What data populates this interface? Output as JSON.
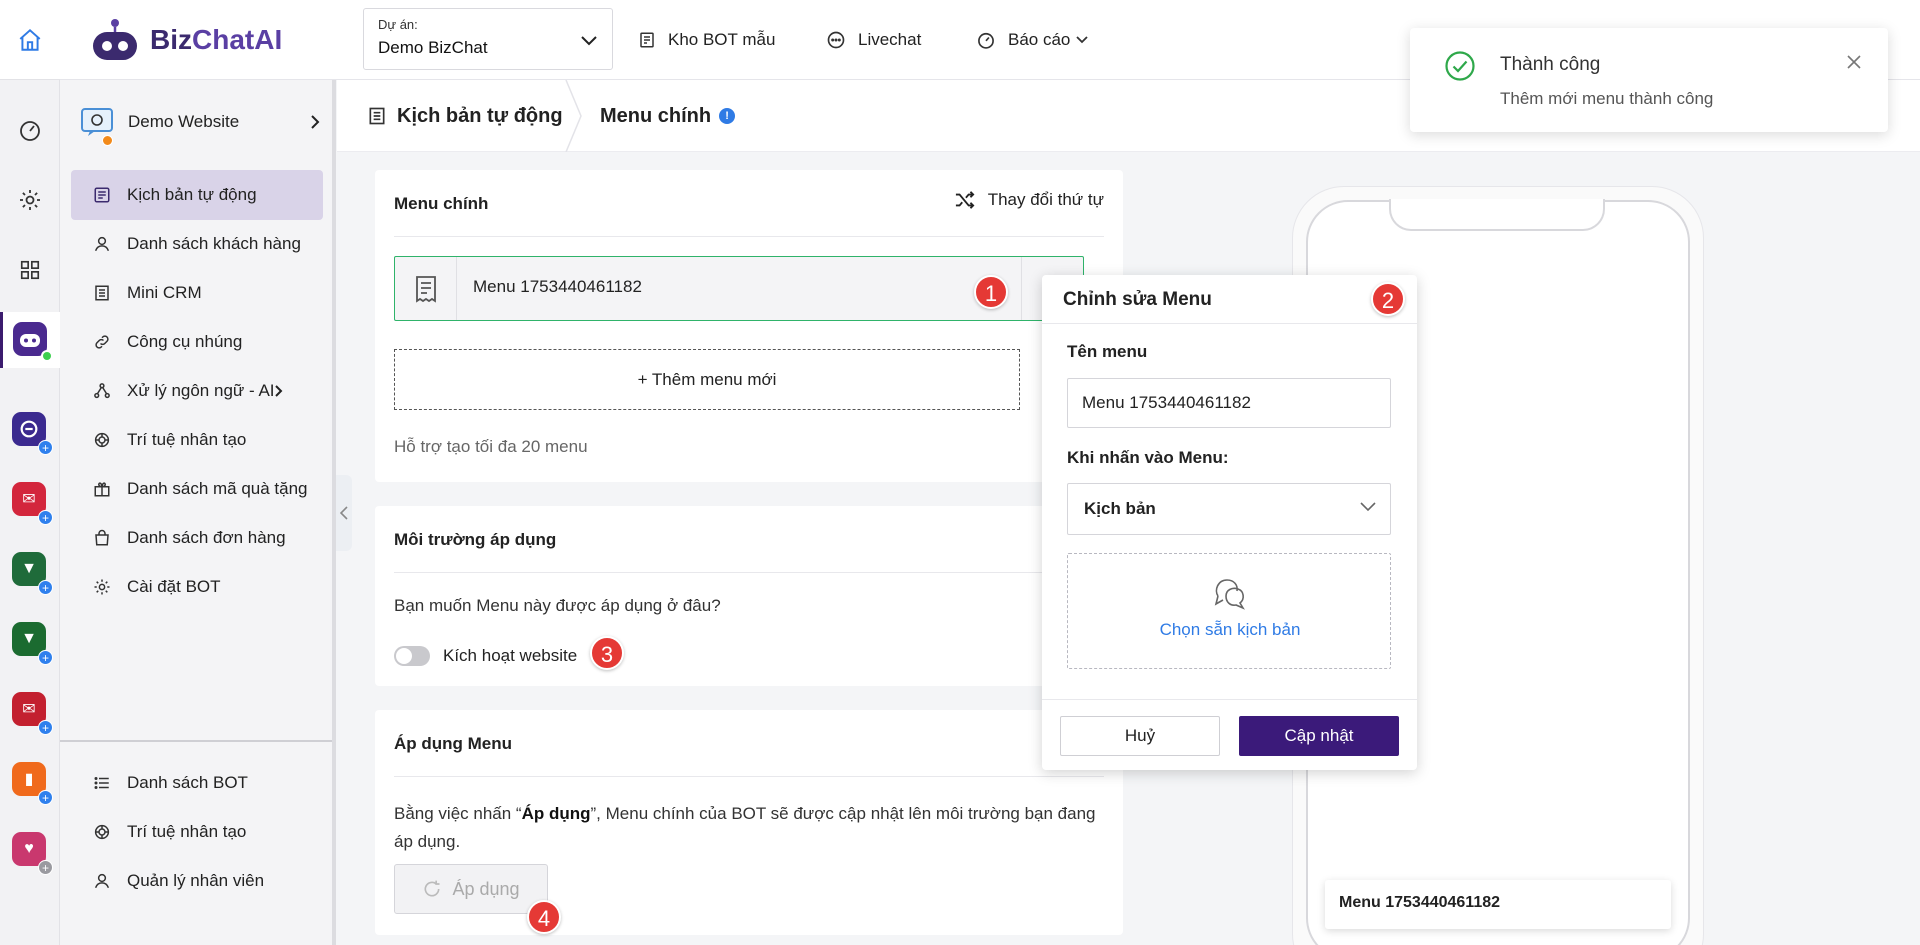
{
  "brand": {
    "name_part1": "Biz",
    "name_part2": "ChatAI",
    "color": "#3b2a6e"
  },
  "header": {
    "project_label": "Dự án:",
    "project_value": "Demo BizChat",
    "nav": [
      {
        "label": "Kho BOT mẫu",
        "icon": "robot-template-icon"
      },
      {
        "label": "Livechat",
        "icon": "chat-bubble-icon"
      },
      {
        "label": "Báo cáo",
        "icon": "dashboard-gauge-icon"
      }
    ]
  },
  "rail": {
    "icons": [
      "home-icon",
      "dashboard-icon",
      "settings-icon",
      "apps-grid-icon",
      "bizchat-bot-icon"
    ],
    "apps": [
      {
        "letter": "",
        "color": "#3b2a8f"
      },
      {
        "letter": "✉",
        "color": "#d3263c"
      },
      {
        "letter": "▼",
        "color": "#1f6b3a"
      },
      {
        "letter": "▼",
        "color": "#1b6b30"
      },
      {
        "letter": "✉",
        "color": "#c3202f"
      },
      {
        "letter": "▮",
        "color": "#f06a1c"
      },
      {
        "letter": "♥",
        "color": "#c9386e"
      }
    ]
  },
  "sidebar": {
    "site_name": "Demo Website",
    "items": [
      {
        "label": "Kịch bản tự động",
        "icon": "script-list-icon",
        "active": true
      },
      {
        "label": "Danh sách khách hàng",
        "icon": "user-icon"
      },
      {
        "label": "Mini CRM",
        "icon": "document-icon"
      },
      {
        "label": "Công cụ nhúng",
        "icon": "link-icon"
      },
      {
        "label": "Xử lý ngôn ngữ - AI",
        "icon": "nodes-icon",
        "has_sub": true
      },
      {
        "label": "Trí tuệ nhân tạo",
        "icon": "ai-swirl-icon"
      },
      {
        "label": "Danh sách mã quà tặng",
        "icon": "gift-icon"
      },
      {
        "label": "Danh sách đơn hàng",
        "icon": "shopping-bag-icon"
      },
      {
        "label": "Cài đặt BOT",
        "icon": "gear-icon"
      }
    ],
    "bottom_items": [
      {
        "label": "Danh sách BOT",
        "icon": "list-icon"
      },
      {
        "label": "Trí tuệ nhân tạo",
        "icon": "ai-swirl-icon"
      },
      {
        "label": "Quản lý nhân viên",
        "icon": "user-icon"
      }
    ]
  },
  "breadcrumb": {
    "parent": "Kịch bản tự động",
    "current": "Menu chính",
    "info": "!"
  },
  "main_menu_card": {
    "title": "Menu chính",
    "reorder_label": "Thay đổi thứ tự",
    "menu_item_name": "Menu 1753440461182",
    "add_label": "+ Thêm menu mới",
    "hint": "Hỗ trợ tạo tối đa 20 menu"
  },
  "env_card": {
    "title": "Môi trường áp dụng",
    "question": "Bạn muốn Menu này được áp dụng ở đâu?",
    "toggle_label": "Kích hoạt website",
    "toggle_on": false
  },
  "apply_card": {
    "title": "Áp dụng Menu",
    "desc_pre": "Bằng việc nhấn “",
    "desc_bold": "Áp dụng",
    "desc_post": "”, Menu chính của BOT sẽ được cập nhật lên môi trường bạn đang áp dụng.",
    "button_label": "Áp dụng"
  },
  "markers": [
    "1",
    "2",
    "3",
    "4"
  ],
  "edit_popover": {
    "title": "Chỉnh sửa Menu",
    "name_label": "Tên menu",
    "name_value": "Menu 1753440461182",
    "action_label": "Khi nhấn vào Menu:",
    "action_value": "Kịch bản",
    "picker_label": "Chọn sẵn kịch bản",
    "cancel_label": "Huỷ",
    "update_label": "Cập nhật",
    "update_color": "#3b1a7a"
  },
  "phone_preview": {
    "menu_label": "Menu 1753440461182"
  },
  "toast": {
    "title": "Thành công",
    "message": "Thêm mới menu thành công",
    "status_color": "#2ea84a"
  }
}
